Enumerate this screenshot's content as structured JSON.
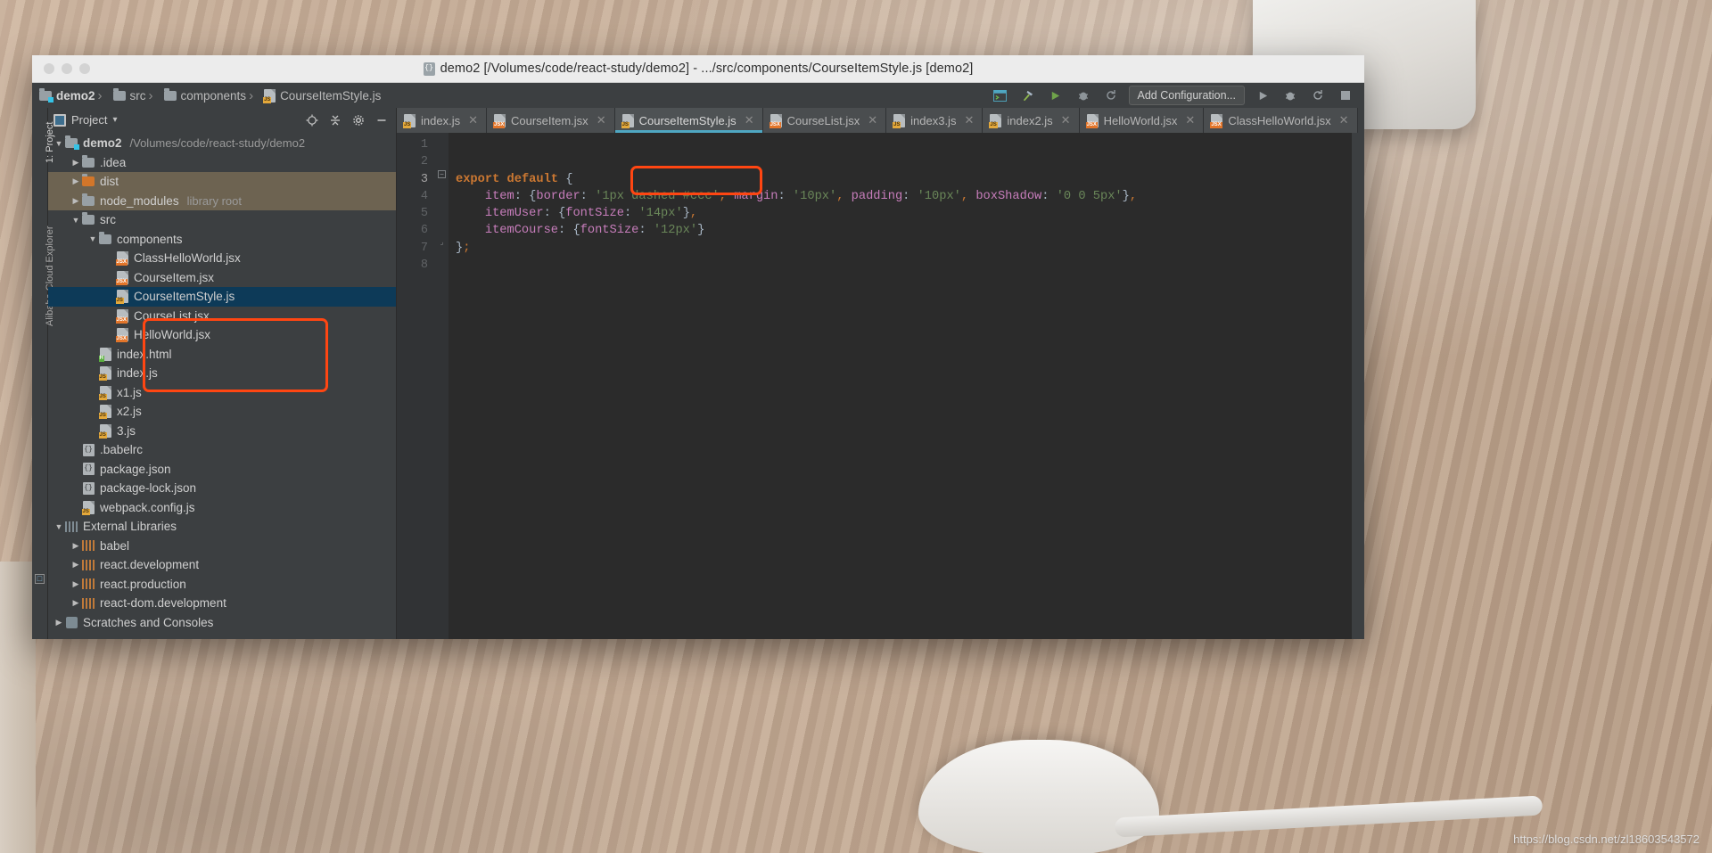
{
  "window": {
    "title": "demo2 [/Volumes/code/react-study/demo2] - .../src/components/CourseItemStyle.js [demo2]",
    "title_icon": "project-icon"
  },
  "breadcrumb": [
    {
      "label": "demo2",
      "icon": "folder-module-icon"
    },
    {
      "label": "src",
      "icon": "folder-icon"
    },
    {
      "label": "components",
      "icon": "folder-icon"
    },
    {
      "label": "CourseItemStyle.js",
      "icon": "js-file-icon"
    }
  ],
  "navbar_right": {
    "run_config_label": "Add Configuration...",
    "icons": [
      "terminal-icon",
      "build-hammer-icon",
      "run-icon",
      "debug-icon",
      "rerun-icon",
      "more-icon"
    ]
  },
  "project_panel": {
    "title": "Project",
    "dropdown_caret": "▾",
    "header_icons": [
      "locate-icon",
      "collapse-all-icon",
      "settings-gear-icon",
      "hide-minus-icon"
    ],
    "tree": [
      {
        "indent": 0,
        "arrow": "▼",
        "icon": "folder-module-icon",
        "label": "demo2",
        "bold": true,
        "sub": "/Volumes/code/react-study/demo2",
        "state": "none"
      },
      {
        "indent": 1,
        "arrow": "▶",
        "icon": "folder-icon",
        "label": ".idea",
        "bold": false,
        "sub": "",
        "state": "none"
      },
      {
        "indent": 1,
        "arrow": "▶",
        "icon": "folder-excluded-icon",
        "label": "dist",
        "bold": false,
        "sub": "",
        "state": "tan"
      },
      {
        "indent": 1,
        "arrow": "▶",
        "icon": "folder-icon",
        "label": "node_modules",
        "bold": false,
        "sub": "library root",
        "state": "tan"
      },
      {
        "indent": 1,
        "arrow": "▼",
        "icon": "folder-icon",
        "label": "src",
        "bold": false,
        "sub": "",
        "state": "none"
      },
      {
        "indent": 2,
        "arrow": "▼",
        "icon": "folder-icon",
        "label": "components",
        "bold": false,
        "sub": "",
        "state": "none"
      },
      {
        "indent": 3,
        "arrow": "",
        "icon": "jsx-file-icon",
        "label": "ClassHelloWorld.jsx",
        "bold": false,
        "sub": "",
        "state": "none"
      },
      {
        "indent": 3,
        "arrow": "",
        "icon": "jsx-file-icon",
        "label": "CourseItem.jsx",
        "bold": false,
        "sub": "",
        "state": "none"
      },
      {
        "indent": 3,
        "arrow": "",
        "icon": "js-file-icon",
        "label": "CourseItemStyle.js",
        "bold": false,
        "sub": "",
        "state": "selected"
      },
      {
        "indent": 3,
        "arrow": "",
        "icon": "jsx-file-icon",
        "label": "CourseList.jsx",
        "bold": false,
        "sub": "",
        "state": "none"
      },
      {
        "indent": 3,
        "arrow": "",
        "icon": "jsx-file-icon",
        "label": "HelloWorld.jsx",
        "bold": false,
        "sub": "",
        "state": "none"
      },
      {
        "indent": 2,
        "arrow": "",
        "icon": "html-file-icon",
        "label": "index.html",
        "bold": false,
        "sub": "",
        "state": "none"
      },
      {
        "indent": 2,
        "arrow": "",
        "icon": "js-file-icon",
        "label": "index.js",
        "bold": false,
        "sub": "",
        "state": "none"
      },
      {
        "indent": 2,
        "arrow": "",
        "icon": "js-file-icon",
        "label": "x1.js",
        "bold": false,
        "sub": "",
        "state": "none"
      },
      {
        "indent": 2,
        "arrow": "",
        "icon": "js-file-icon",
        "label": "x2.js",
        "bold": false,
        "sub": "",
        "state": "none"
      },
      {
        "indent": 2,
        "arrow": "",
        "icon": "js-file-icon",
        "label": "3.js",
        "bold": false,
        "sub": "",
        "state": "none"
      },
      {
        "indent": 1,
        "arrow": "",
        "icon": "json-file-icon",
        "label": ".babelrc",
        "bold": false,
        "sub": "",
        "state": "none"
      },
      {
        "indent": 1,
        "arrow": "",
        "icon": "json-file-icon",
        "label": "package.json",
        "bold": false,
        "sub": "",
        "state": "none"
      },
      {
        "indent": 1,
        "arrow": "",
        "icon": "json-file-icon",
        "label": "package-lock.json",
        "bold": false,
        "sub": "",
        "state": "none"
      },
      {
        "indent": 1,
        "arrow": "",
        "icon": "js-file-icon",
        "label": "webpack.config.js",
        "bold": false,
        "sub": "",
        "state": "none"
      },
      {
        "indent": 0,
        "arrow": "▼",
        "icon": "library-icon",
        "label": "External Libraries",
        "bold": false,
        "sub": "",
        "state": "none"
      },
      {
        "indent": 1,
        "arrow": "▶",
        "icon": "library-node-icon",
        "label": "babel",
        "bold": false,
        "sub": "",
        "state": "none"
      },
      {
        "indent": 1,
        "arrow": "▶",
        "icon": "library-node-icon",
        "label": "react.development",
        "bold": false,
        "sub": "",
        "state": "none"
      },
      {
        "indent": 1,
        "arrow": "▶",
        "icon": "library-node-icon",
        "label": "react.production",
        "bold": false,
        "sub": "",
        "state": "none"
      },
      {
        "indent": 1,
        "arrow": "▶",
        "icon": "library-node-icon",
        "label": "react-dom.development",
        "bold": false,
        "sub": "",
        "state": "none"
      },
      {
        "indent": 0,
        "arrow": "▶",
        "icon": "scratches-icon",
        "label": "Scratches and Consoles",
        "bold": false,
        "sub": "",
        "state": "none"
      }
    ]
  },
  "left_rail": {
    "project_label": "1: Project",
    "cloud_label": "Alibaba Cloud Explorer",
    "bottom_icon": "terminal-square-icon"
  },
  "editor_tabs": [
    {
      "label": "index.js",
      "icon": "js-file-icon",
      "active": false
    },
    {
      "label": "CourseItem.jsx",
      "icon": "jsx-file-icon",
      "active": false
    },
    {
      "label": "CourseItemStyle.js",
      "icon": "js-file-icon",
      "active": true
    },
    {
      "label": "CourseList.jsx",
      "icon": "jsx-file-icon",
      "active": false
    },
    {
      "label": "index3.js",
      "icon": "js-file-icon",
      "active": false
    },
    {
      "label": "index2.js",
      "icon": "js-file-icon",
      "active": false
    },
    {
      "label": "HelloWorld.jsx",
      "icon": "jsx-file-icon",
      "active": false
    },
    {
      "label": "ClassHelloWorld.jsx",
      "icon": "jsx-file-icon",
      "active": false
    }
  ],
  "editor": {
    "line_numbers": [
      "1",
      "2",
      "3",
      "4",
      "5",
      "6",
      "7",
      "8"
    ],
    "code_lines": [
      "",
      "",
      "export default {",
      "    item: {border: '1px dashed #ccc', margin: '10px', padding: '10px', boxShadow: '0 0 5px'},",
      "    itemUser: {fontSize: '14px'},",
      "    itemCourse: {fontSize: '12px'}",
      "};",
      ""
    ]
  },
  "annotations": [
    {
      "name": "tab-highlight",
      "target": "CourseItemStyle.js tab"
    },
    {
      "name": "tree-highlight",
      "target": "CourseItem.jsx / CourseItemStyle.js / CourseList.jsx"
    }
  ],
  "watermark": "https://blog.csdn.net/zl18603543572",
  "colors": {
    "accent_annotation": "#ff4612",
    "tab_active_underline": "#4fa7c2",
    "tree_selection": "#0d3a58",
    "editor_bg": "#2b2b2b",
    "panel_bg": "#3c3f41"
  }
}
